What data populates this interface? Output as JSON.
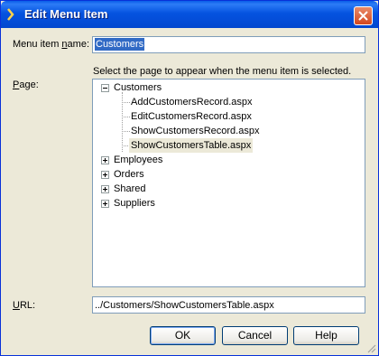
{
  "window": {
    "title": "Edit Menu Item"
  },
  "form": {
    "menu_item_name_label_pre": "Menu item ",
    "menu_item_name_label_u": "n",
    "menu_item_name_label_post": "ame:",
    "menu_item_name_value": "Customers",
    "instruction": "Select the page to appear when the menu item is selected.",
    "page_label_u": "P",
    "page_label_post": "age:",
    "url_label_u": "U",
    "url_label_post": "RL:",
    "url_value": "../Customers/ShowCustomersTable.aspx"
  },
  "tree": {
    "nodes": [
      {
        "label": "Customers",
        "state": "expanded"
      },
      {
        "label": "AddCustomersRecord.aspx"
      },
      {
        "label": "EditCustomersRecord.aspx"
      },
      {
        "label": "ShowCustomersRecord.aspx"
      },
      {
        "label": "ShowCustomersTable.aspx",
        "selected": true
      },
      {
        "label": "Employees",
        "state": "collapsed"
      },
      {
        "label": "Orders",
        "state": "collapsed"
      },
      {
        "label": "Shared",
        "state": "collapsed"
      },
      {
        "label": "Suppliers",
        "state": "collapsed"
      }
    ]
  },
  "buttons": {
    "ok": "OK",
    "cancel": "Cancel",
    "help": "Help"
  },
  "colors": {
    "title_bar": "#0553e0",
    "selection": "#316ac5",
    "dialog_bg": "#ece9d8"
  }
}
